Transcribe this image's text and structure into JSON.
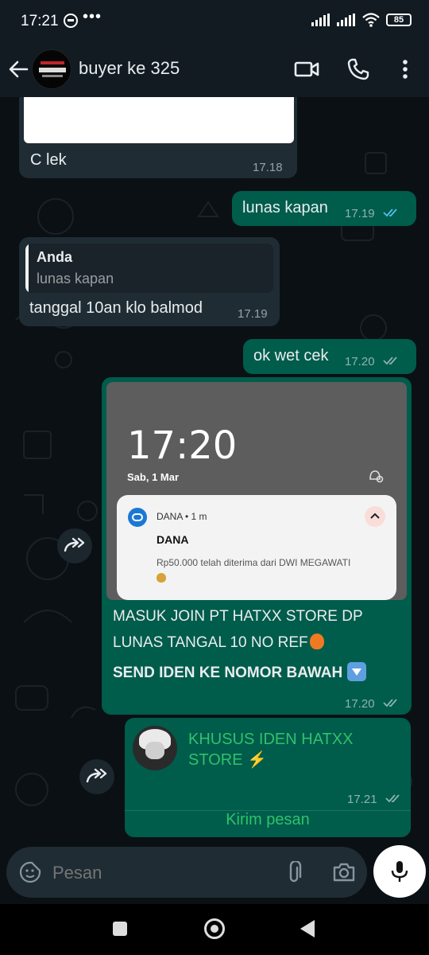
{
  "status_bar": {
    "time": "17:21",
    "dots": "•••",
    "battery": "85"
  },
  "header": {
    "contact_name": "buyer ke 325"
  },
  "messages": [
    {
      "dir": "in",
      "text": "C lek",
      "time": "17.18"
    },
    {
      "dir": "out",
      "text": "lunas kapan",
      "time": "17.19",
      "status": "read"
    },
    {
      "dir": "in",
      "quote_author": "Anda",
      "quote_text": "lunas kapan",
      "text": "tanggal 10an klo balmod",
      "time": "17.19"
    },
    {
      "dir": "out",
      "text": "ok wet cek",
      "time": "17.20",
      "status": "delivered"
    },
    {
      "dir": "out",
      "forwardable": true,
      "image": {
        "clock": "17:20",
        "date": "Sab, 1 Mar",
        "notification": {
          "app": "DANA • 1 m",
          "title": "DANA",
          "body": "Rp50.000 telah diterima dari DWI MEGAWATI"
        }
      },
      "caption_line1": "MASUK JOIN PT HATXX STORE DP",
      "caption_line2": "LUNAS TANGAL  10 NO REF",
      "caption_line3": "SEND IDEN KE NOMOR BAWAH",
      "time": "17.20",
      "status": "delivered"
    },
    {
      "dir": "out",
      "forwardable": true,
      "contact_card": {
        "name_line1": "KHUSUS IDEN HATXX",
        "name_line2": "STORE",
        "bolt": "⚡",
        "button": "Kirim pesan"
      },
      "time": "17.21",
      "status": "delivered"
    }
  ],
  "composer": {
    "placeholder": "Pesan"
  },
  "colors": {
    "incoming": "#1f2c34",
    "outgoing": "#005c4b",
    "read_ticks": "#53bdeb",
    "accent_green": "#2fc26b"
  }
}
